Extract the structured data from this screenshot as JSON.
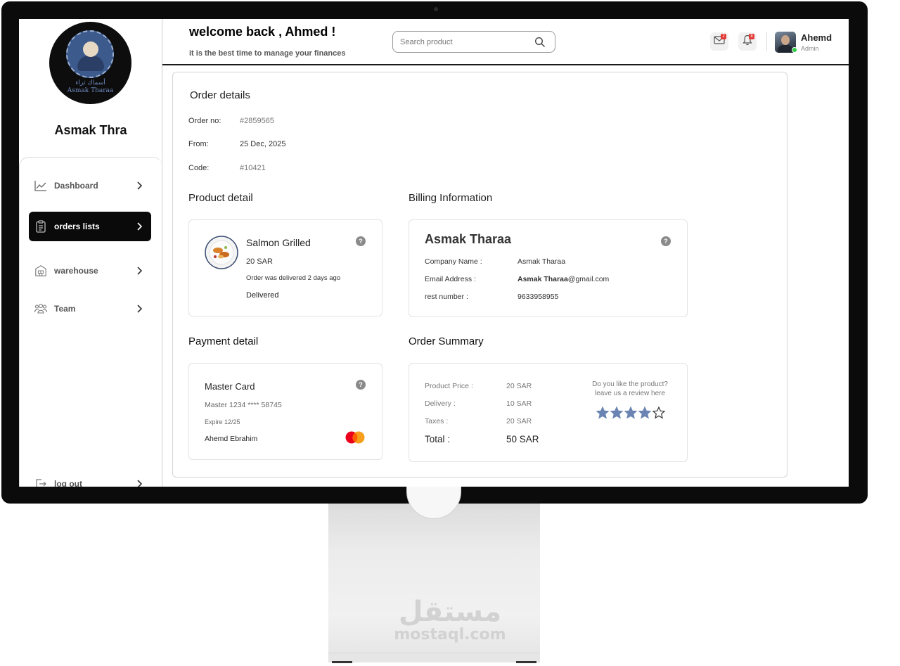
{
  "brand": {
    "logo_text_ar": "أسماك ثراء",
    "logo_text_en": "Asmak Tharaa",
    "name": "Asmak Thra"
  },
  "sidebar": {
    "items": [
      {
        "label": "Dashboard",
        "icon": "chart-line-icon",
        "active": false
      },
      {
        "label": "orders lists",
        "icon": "clipboard-icon",
        "active": true
      },
      {
        "label": "warehouse",
        "icon": "warehouse-icon",
        "active": false
      },
      {
        "label": "Team",
        "icon": "team-icon",
        "active": false
      }
    ],
    "logout_label": "log out"
  },
  "header": {
    "welcome": "welcome back , Ahmed !",
    "subtitle": "it is the best time to manage your finances",
    "search_placeholder": "Search product",
    "mail_badge": "2",
    "notif_badge": "8",
    "user_name": "Ahemd",
    "user_role": "Admin"
  },
  "order_details": {
    "title": "Order details",
    "rows": [
      {
        "label": "Order no:",
        "value": "#2859565"
      },
      {
        "label": "From:",
        "value": "25 Dec, 2025"
      },
      {
        "label": "Code:",
        "value": "#10421"
      }
    ]
  },
  "product_detail": {
    "title": "Product detail",
    "name": "Salmon Grilled",
    "price": "20 SAR",
    "note": "Order was delivered 2 days ago",
    "status": "Delivered"
  },
  "billing": {
    "title": "Billing Information",
    "name": "Asmak Tharaa",
    "company_label": "Company Name :",
    "company_value": "Asmak Tharaa",
    "email_label": "Email Address :",
    "email_user": "Asmak Tharaa",
    "email_domain": "@gmail.com",
    "rest_label": "rest number :",
    "rest_value": "9633958955"
  },
  "payment": {
    "title": "Payment detail",
    "card_type": "Master Card",
    "card_number": "Master 1234 **** 58745",
    "expire": "Expire 12/25",
    "holder": "Ahemd Ebrahim"
  },
  "summary": {
    "title": "Order Summary",
    "product_price_label": "Product Price :",
    "product_price_value": "20 SAR",
    "delivery_label": "Delivery :",
    "delivery_value": "10 SAR",
    "taxes_label": "Taxes :",
    "taxes_value": "20 SAR",
    "total_label": "Total :",
    "total_value": "50 SAR",
    "review_line1": "Do you like the product?",
    "review_line2": "leave us a review here",
    "rating": 4,
    "rating_max": 5,
    "star_color": "#6b84b3"
  },
  "watermark": {
    "ar": "مستقل",
    "en": "mostaql.com"
  }
}
